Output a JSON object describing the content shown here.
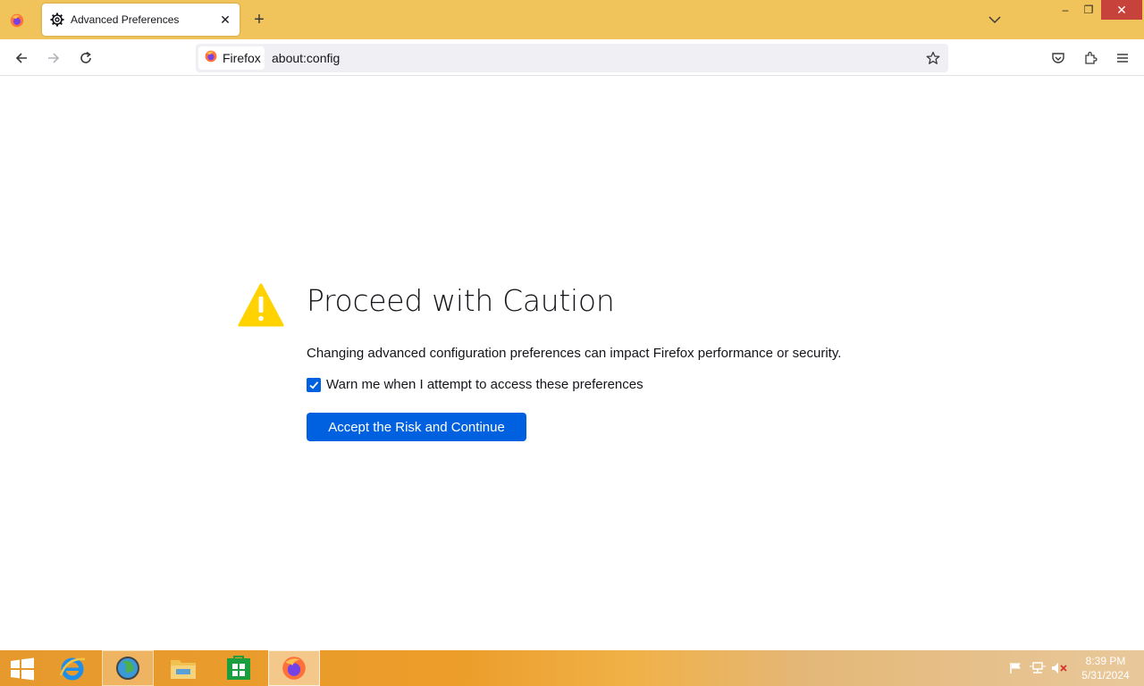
{
  "browser": {
    "tab": {
      "title": "Advanced Preferences",
      "close_glyph": "✕"
    },
    "new_tab_glyph": "+",
    "window_controls": {
      "minimize": "–",
      "maximize": "❐",
      "close": "✕"
    },
    "urlbar": {
      "identity_label": "Firefox",
      "url": "about:config"
    }
  },
  "page": {
    "headline": "Proceed with Caution",
    "description": "Changing advanced configuration preferences can impact Firefox performance or security.",
    "checkbox": {
      "label": "Warn me when I attempt to access these preferences",
      "checked": true
    },
    "accept_button": "Accept the Risk and Continue"
  },
  "taskbar": {
    "items": [
      "internet-explorer-icon",
      "globe-app-icon",
      "file-explorer-icon",
      "store-icon",
      "firefox-icon"
    ],
    "clock": {
      "time": "8:39 PM",
      "date": "5/31/2024"
    }
  },
  "colors": {
    "accent_blue": "#0061e0",
    "titlebar": "#f0c45a",
    "warning_yellow": "#ffd200"
  }
}
